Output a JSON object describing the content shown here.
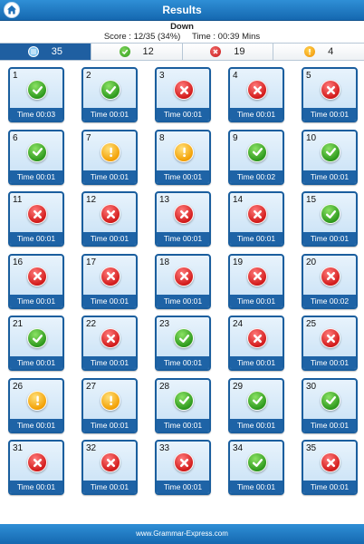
{
  "header": {
    "title": "Results"
  },
  "summary": {
    "category": "Down",
    "score": "Score : 12/35 (34%)",
    "time": "Time : 00:39 Mins"
  },
  "stats": [
    {
      "kind": "total",
      "value": "35",
      "active": true
    },
    {
      "kind": "correct",
      "value": "12",
      "active": false
    },
    {
      "kind": "wrong",
      "value": "19",
      "active": false
    },
    {
      "kind": "skipped",
      "value": "4",
      "active": false
    }
  ],
  "questions": [
    {
      "num": "1",
      "status": "correct",
      "time": "Time 00:03"
    },
    {
      "num": "2",
      "status": "correct",
      "time": "Time 00:01"
    },
    {
      "num": "3",
      "status": "wrong",
      "time": "Time 00:01"
    },
    {
      "num": "4",
      "status": "wrong",
      "time": "Time 00:01"
    },
    {
      "num": "5",
      "status": "wrong",
      "time": "Time 00:01"
    },
    {
      "num": "6",
      "status": "correct",
      "time": "Time 00:01"
    },
    {
      "num": "7",
      "status": "skipped",
      "time": "Time 00:01"
    },
    {
      "num": "8",
      "status": "skipped",
      "time": "Time 00:01"
    },
    {
      "num": "9",
      "status": "correct",
      "time": "Time 00:02"
    },
    {
      "num": "10",
      "status": "correct",
      "time": "Time 00:01"
    },
    {
      "num": "11",
      "status": "wrong",
      "time": "Time 00:01"
    },
    {
      "num": "12",
      "status": "wrong",
      "time": "Time 00:01"
    },
    {
      "num": "13",
      "status": "wrong",
      "time": "Time 00:01"
    },
    {
      "num": "14",
      "status": "wrong",
      "time": "Time 00:01"
    },
    {
      "num": "15",
      "status": "correct",
      "time": "Time 00:01"
    },
    {
      "num": "16",
      "status": "wrong",
      "time": "Time 00:01"
    },
    {
      "num": "17",
      "status": "wrong",
      "time": "Time 00:01"
    },
    {
      "num": "18",
      "status": "wrong",
      "time": "Time 00:01"
    },
    {
      "num": "19",
      "status": "wrong",
      "time": "Time 00:01"
    },
    {
      "num": "20",
      "status": "wrong",
      "time": "Time 00:02"
    },
    {
      "num": "21",
      "status": "correct",
      "time": "Time 00:01"
    },
    {
      "num": "22",
      "status": "wrong",
      "time": "Time 00:01"
    },
    {
      "num": "23",
      "status": "correct",
      "time": "Time 00:01"
    },
    {
      "num": "24",
      "status": "wrong",
      "time": "Time 00:01"
    },
    {
      "num": "25",
      "status": "wrong",
      "time": "Time 00:01"
    },
    {
      "num": "26",
      "status": "skipped",
      "time": "Time 00:01"
    },
    {
      "num": "27",
      "status": "skipped",
      "time": "Time 00:01"
    },
    {
      "num": "28",
      "status": "correct",
      "time": "Time 00:01"
    },
    {
      "num": "29",
      "status": "correct",
      "time": "Time 00:01"
    },
    {
      "num": "30",
      "status": "correct",
      "time": "Time 00:01"
    },
    {
      "num": "31",
      "status": "wrong",
      "time": "Time 00:01"
    },
    {
      "num": "32",
      "status": "wrong",
      "time": "Time 00:01"
    },
    {
      "num": "33",
      "status": "wrong",
      "time": "Time 00:01"
    },
    {
      "num": "34",
      "status": "correct",
      "time": "Time 00:01"
    },
    {
      "num": "35",
      "status": "wrong",
      "time": "Time 00:01"
    }
  ],
  "icons": {
    "home": "home-icon",
    "correct": "check-icon",
    "wrong": "cross-icon",
    "skipped": "exclamation-icon"
  },
  "footer": {
    "text": "www.Grammar-Express.com"
  }
}
